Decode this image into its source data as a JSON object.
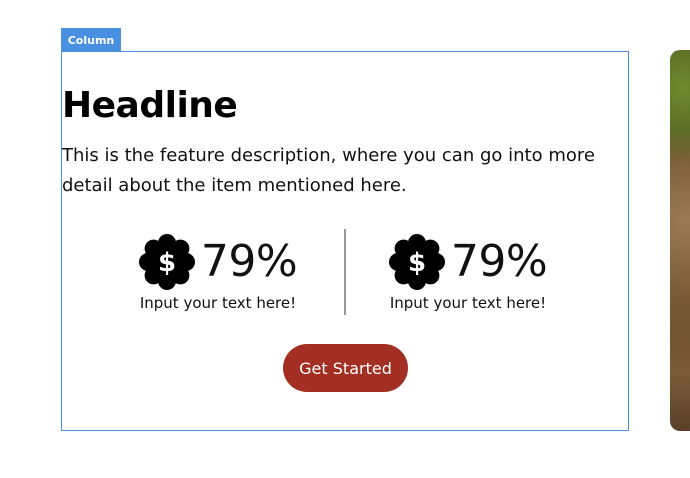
{
  "editor": {
    "column_tag": "Column"
  },
  "feature": {
    "headline": "Headline",
    "description": "This is the feature description, where you can go into more detail about the item mentioned here.",
    "stats": [
      {
        "icon": "dollar-badge-icon",
        "value": "79%",
        "label": "Input your text here!"
      },
      {
        "icon": "dollar-badge-icon",
        "value": "79%",
        "label": "Input your text here!"
      }
    ],
    "cta_label": "Get Started"
  },
  "colors": {
    "selection_blue": "#4a90e2",
    "button_red": "#a32f22",
    "divider_gray": "#9a9a9a"
  }
}
